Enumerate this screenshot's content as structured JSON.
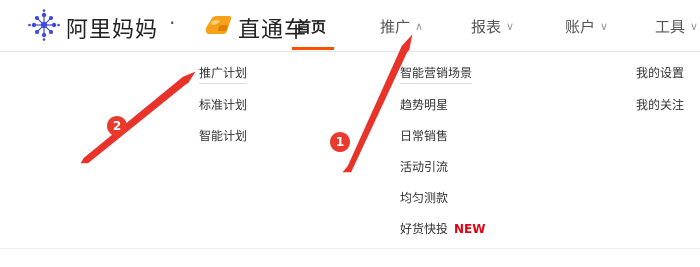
{
  "header": {
    "brand": "阿里妈妈",
    "separator": "·",
    "product": "直通车",
    "nav": [
      {
        "label": "首页",
        "active": true
      },
      {
        "label": "推广",
        "expanded": true
      },
      {
        "label": "报表"
      },
      {
        "label": "账户"
      },
      {
        "label": "工具"
      }
    ]
  },
  "dropdown": {
    "col1": [
      "推广计划",
      "标准计划",
      "智能计划"
    ],
    "col2": [
      "智能营销场景",
      "趋势明星",
      "日常销售",
      "活动引流",
      "均匀测款",
      "好货快投"
    ],
    "col2_badge": "NEW",
    "col3": [
      "我的设置",
      "我的关注"
    ]
  },
  "annotations": {
    "step1": "1",
    "step2": "2",
    "color": "#e8332a"
  },
  "colors": {
    "accent": "#ff5000",
    "brand_blue": "#3d4bd8",
    "car_orange": "#f7a11a"
  }
}
